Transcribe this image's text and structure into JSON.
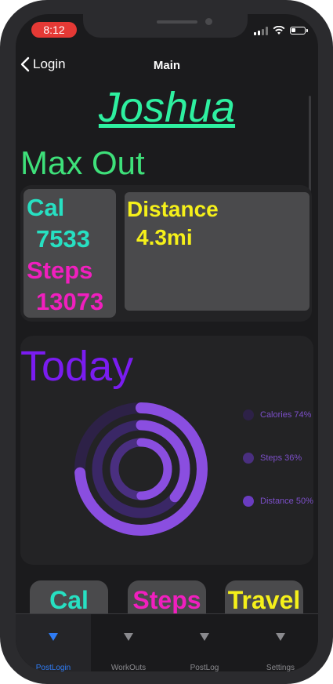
{
  "status_bar": {
    "time": "8:12"
  },
  "nav": {
    "back_label": "Login",
    "title": "Main"
  },
  "user": {
    "name": "Joshua"
  },
  "max_out": {
    "title": "Max Out",
    "cal_label": "Cal",
    "cal_value": "7533",
    "steps_label": "Steps",
    "steps_value": "13073",
    "distance_label": "Distance",
    "distance_value": "4.3mi"
  },
  "today": {
    "title": "Today",
    "rings": [
      {
        "name": "Calories",
        "percent": 74
      },
      {
        "name": "Steps",
        "percent": 36
      },
      {
        "name": "Distance",
        "percent": 50
      }
    ],
    "legend": [
      "Calories 74%",
      "Steps 36%",
      "Distance 50%"
    ]
  },
  "buttons": {
    "cal": "Cal",
    "steps": "Steps",
    "travel": "Travel"
  },
  "tabs": [
    {
      "label": "PostLogin",
      "active": true
    },
    {
      "label": "WorkOuts",
      "active": false
    },
    {
      "label": "PostLog",
      "active": false
    },
    {
      "label": "Settings",
      "active": false
    }
  ],
  "colors": {
    "name": "#2ef0a0",
    "max_out": "#3ee07a",
    "cal": "#27e0c2",
    "steps": "#f01fbe",
    "distance": "#f5f01a",
    "today": "#7a1cf0",
    "ring_active": "#8a4ee0",
    "ring_track": "#3b2a63",
    "tab_active": "#2f7cf5"
  }
}
